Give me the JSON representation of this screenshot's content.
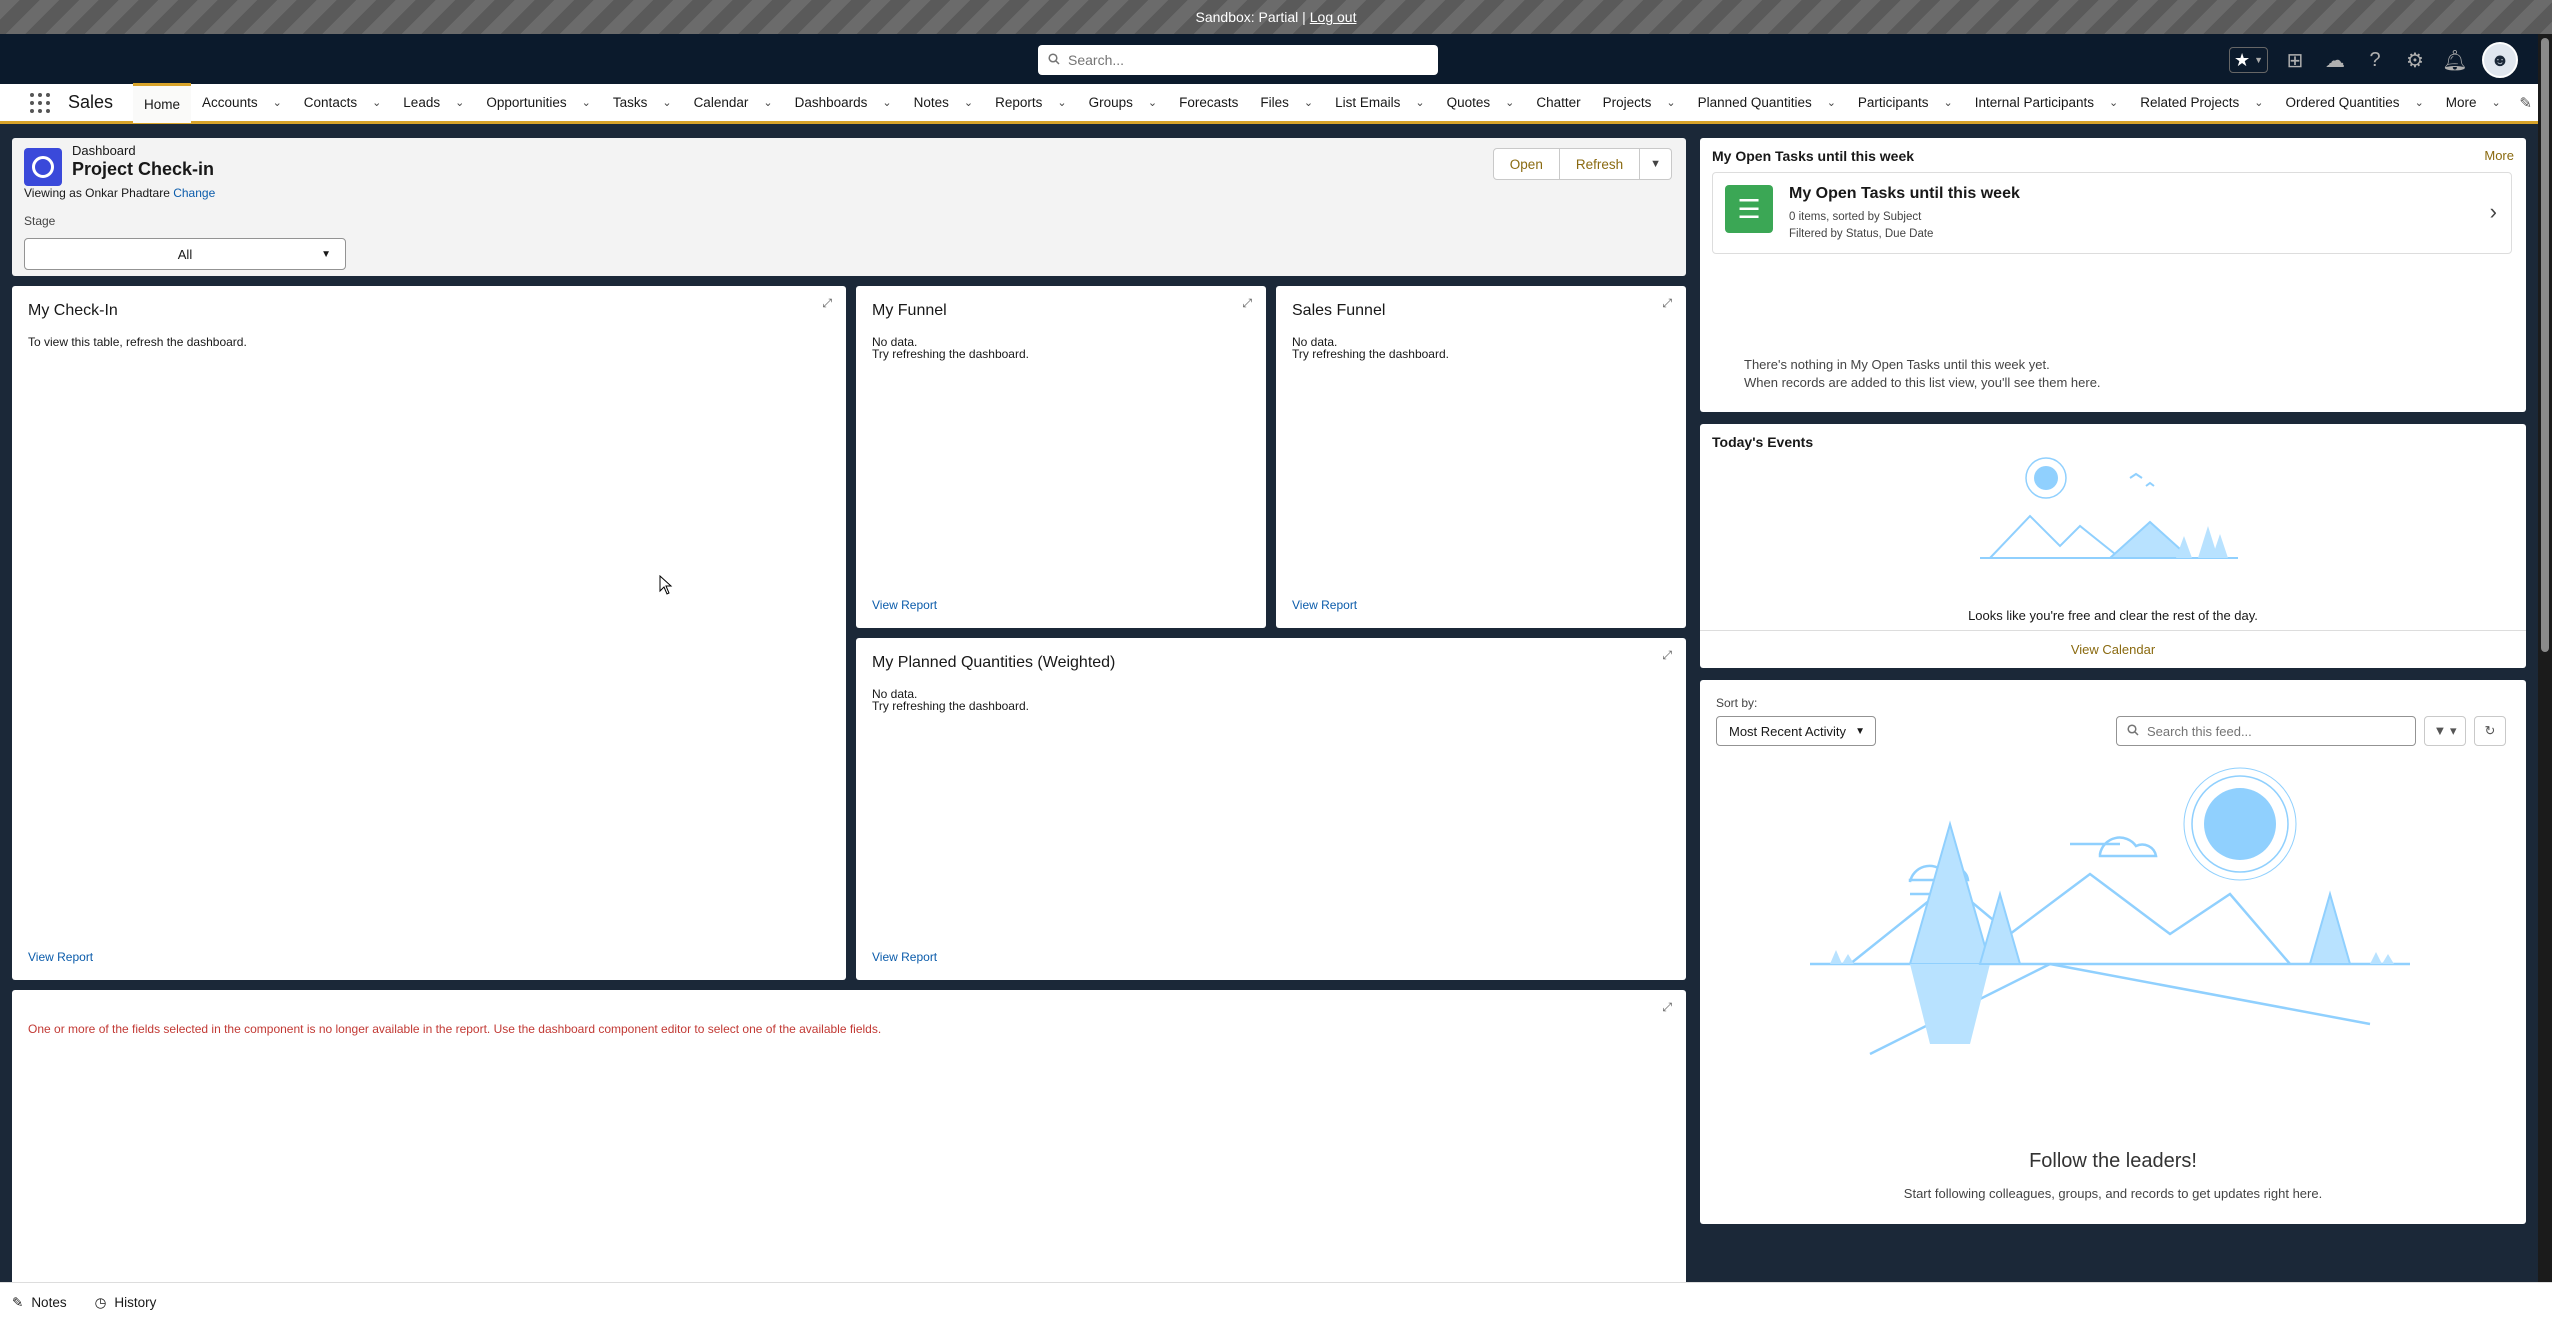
{
  "sandbox": {
    "label": "Sandbox: Partial |",
    "logout": "Log out"
  },
  "header": {
    "search_placeholder": "Search..."
  },
  "nav": {
    "app_name": "Sales",
    "items": [
      {
        "label": "Home",
        "dropdown": false
      },
      {
        "label": "Accounts",
        "dropdown": true
      },
      {
        "label": "Contacts",
        "dropdown": true
      },
      {
        "label": "Leads",
        "dropdown": true
      },
      {
        "label": "Opportunities",
        "dropdown": true
      },
      {
        "label": "Tasks",
        "dropdown": true
      },
      {
        "label": "Calendar",
        "dropdown": true
      },
      {
        "label": "Dashboards",
        "dropdown": true
      },
      {
        "label": "Notes",
        "dropdown": true
      },
      {
        "label": "Reports",
        "dropdown": true
      },
      {
        "label": "Groups",
        "dropdown": true
      },
      {
        "label": "Forecasts",
        "dropdown": false
      },
      {
        "label": "Files",
        "dropdown": true
      },
      {
        "label": "List Emails",
        "dropdown": true
      },
      {
        "label": "Quotes",
        "dropdown": true
      },
      {
        "label": "Chatter",
        "dropdown": false
      },
      {
        "label": "Projects",
        "dropdown": true
      },
      {
        "label": "Planned Quantities",
        "dropdown": true
      },
      {
        "label": "Participants",
        "dropdown": true
      },
      {
        "label": "Internal Participants",
        "dropdown": true
      },
      {
        "label": "Related Projects",
        "dropdown": true
      },
      {
        "label": "Ordered Quantities",
        "dropdown": true
      },
      {
        "label": "More",
        "dropdown": true
      }
    ]
  },
  "dashboard": {
    "label": "Dashboard",
    "title": "Project Check-in",
    "viewing_as": "Viewing as Onkar Phadtare",
    "change": "Change",
    "stage_label": "Stage",
    "stage_value": "All",
    "open_button": "Open",
    "refresh_button": "Refresh"
  },
  "components": {
    "checkin": {
      "title": "My Check-In",
      "message": "To view this table, refresh the dashboard.",
      "link": "View Report"
    },
    "funnel": {
      "title": "My Funnel",
      "line1": "No data.",
      "line2": "Try refreshing the dashboard.",
      "link": "View Report"
    },
    "sales_funnel": {
      "title": "Sales Funnel",
      "line1": "No data.",
      "line2": "Try refreshing the dashboard.",
      "link": "View Report"
    },
    "planned": {
      "title": "My Planned Quantities (Weighted)",
      "line1": "No data.",
      "line2": "Try refreshing the dashboard.",
      "link": "View Report"
    },
    "error": {
      "message": "One or more of the fields selected in the component is no longer available in the report. Use the dashboard component editor to select one of the available fields."
    }
  },
  "tasks": {
    "header": "My Open Tasks until this week",
    "more": "More",
    "card_title": "My Open Tasks until this week",
    "card_sub1": "0 items, sorted by Subject",
    "card_sub2": "Filtered by Status, Due Date",
    "empty1": "There's nothing in My Open Tasks until this week yet.",
    "empty2": "When records are added to this list view, you'll see them here."
  },
  "events": {
    "title": "Today's Events",
    "free_text": "Looks like you're free and clear the rest of the day.",
    "view_calendar": "View Calendar"
  },
  "feed": {
    "sort_label": "Sort by:",
    "sort_value": "Most Recent Activity",
    "search_placeholder": "Search this feed...",
    "follow_title": "Follow the leaders!",
    "follow_sub": "Start following colleagues, groups, and records to get updates right here."
  },
  "footer": {
    "notes": "Notes",
    "history": "History"
  },
  "colors": {
    "accent": "#d8a32a",
    "link": "#0b5cab",
    "error": "#c23934",
    "brand_dashboard": "#3a49da",
    "tasks_green": "#3ba755",
    "illustration": "#90d0fe"
  }
}
